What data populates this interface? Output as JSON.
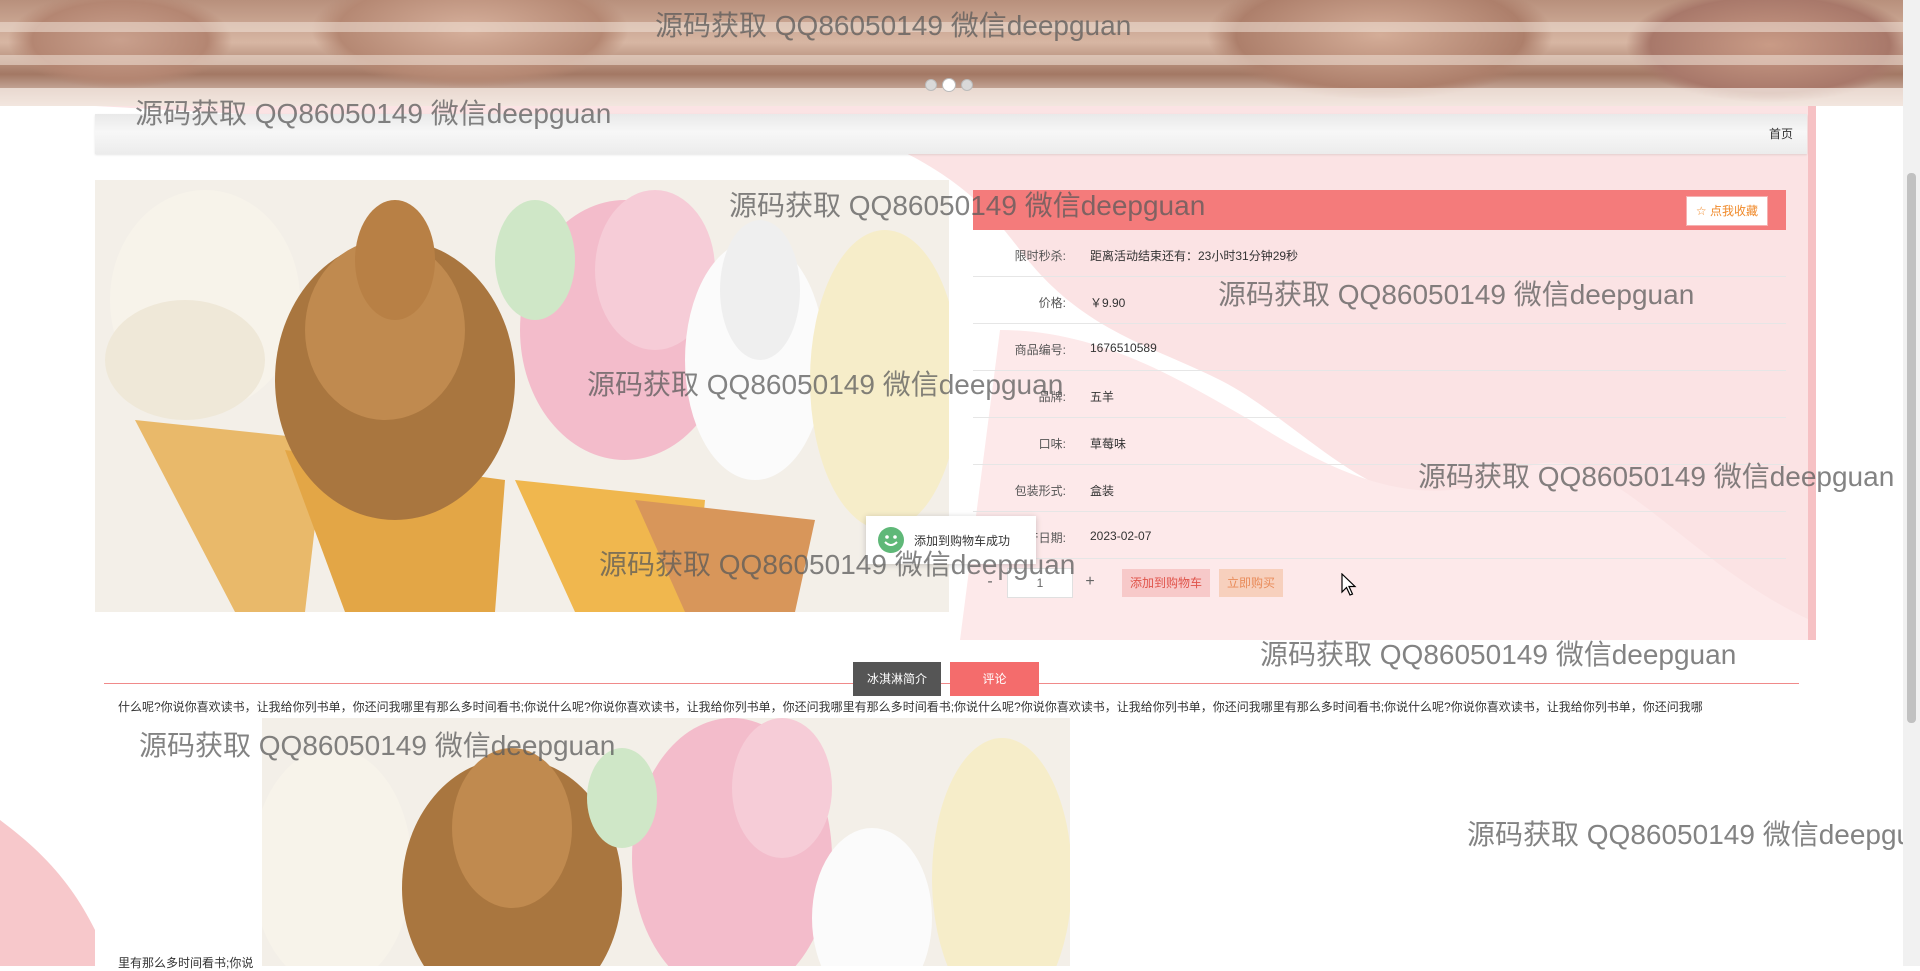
{
  "watermark_text": "源码获取 QQ86050149 微信deepguan",
  "nav": {
    "home": "首页"
  },
  "favorite_button": "☆ 点我收藏",
  "details": [
    {
      "label": "限时秒杀:",
      "value": "距离活动结束还有：23小时31分钟29秒"
    },
    {
      "label": "价格:",
      "value": "￥9.90"
    },
    {
      "label": "商品编号:",
      "value": "1676510589"
    },
    {
      "label": "品牌:",
      "value": "五羊"
    },
    {
      "label": "口味:",
      "value": "草莓味"
    },
    {
      "label": "包装形式:",
      "value": "盒装"
    },
    {
      "label": "生产日期:",
      "value": "2023-02-07"
    }
  ],
  "quantity": {
    "minus": "-",
    "value": "1",
    "plus": "+"
  },
  "buttons": {
    "add_to_cart": "添加到购物车",
    "buy_now": "立即购买"
  },
  "toast": "添加到购物车成功",
  "tabs": {
    "intro": "冰淇淋简介",
    "comments": "评论"
  },
  "description": "什么呢?你说你喜欢读书，让我给你列书单，你还问我哪里有那么多时间看书;你说什么呢?你说你喜欢读书，让我给你列书单，你还问我哪里有那么多时间看书;你说什么呢?你说你喜欢读书，让我给你列书单，你还问我哪里有那么多时间看书;你说什么呢?你说你喜欢读书，让我给你列书单，你还问我哪",
  "description_tail": "里有那么多时间看书;你说",
  "colors": {
    "accent": "#f47b7b",
    "pink_bg": "#f9d9db"
  }
}
